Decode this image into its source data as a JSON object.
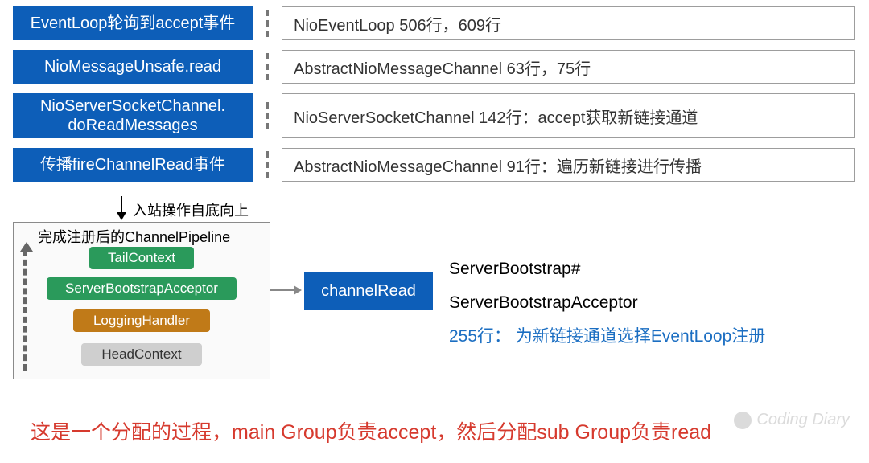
{
  "rows": [
    {
      "step": "EventLoop轮询到accept事件",
      "desc": "NioEventLoop 506行，609行"
    },
    {
      "step": "NioMessageUnsafe.read",
      "desc": "AbstractNioMessageChannel 63行，75行"
    },
    {
      "step": "NioServerSocketChannel.\ndoReadMessages",
      "desc": "NioServerSocketChannel 142行：accept获取新链接通道"
    },
    {
      "step": "传播fireChannelRead事件",
      "desc": "AbstractNioMessageChannel 91行：遍历新链接进行传播"
    }
  ],
  "down_arrow_label": "入站操作自底向上",
  "pipeline": {
    "title": "完成注册后的ChannelPipeline",
    "contexts": {
      "tail": "TailContext",
      "acceptor": "ServerBootstrapAcceptor",
      "logging": "LoggingHandler",
      "head": "HeadContext"
    }
  },
  "channel_read": "channelRead",
  "right_notes": {
    "line1": "ServerBootstrap#",
    "line2": "ServerBootstrapAcceptor",
    "line3": "255行：  为新链接通道选择EventLoop注册"
  },
  "footer": "这是一个分配的过程，main Group负责accept，然后分配sub Group负责read",
  "watermark": "Coding Diary"
}
